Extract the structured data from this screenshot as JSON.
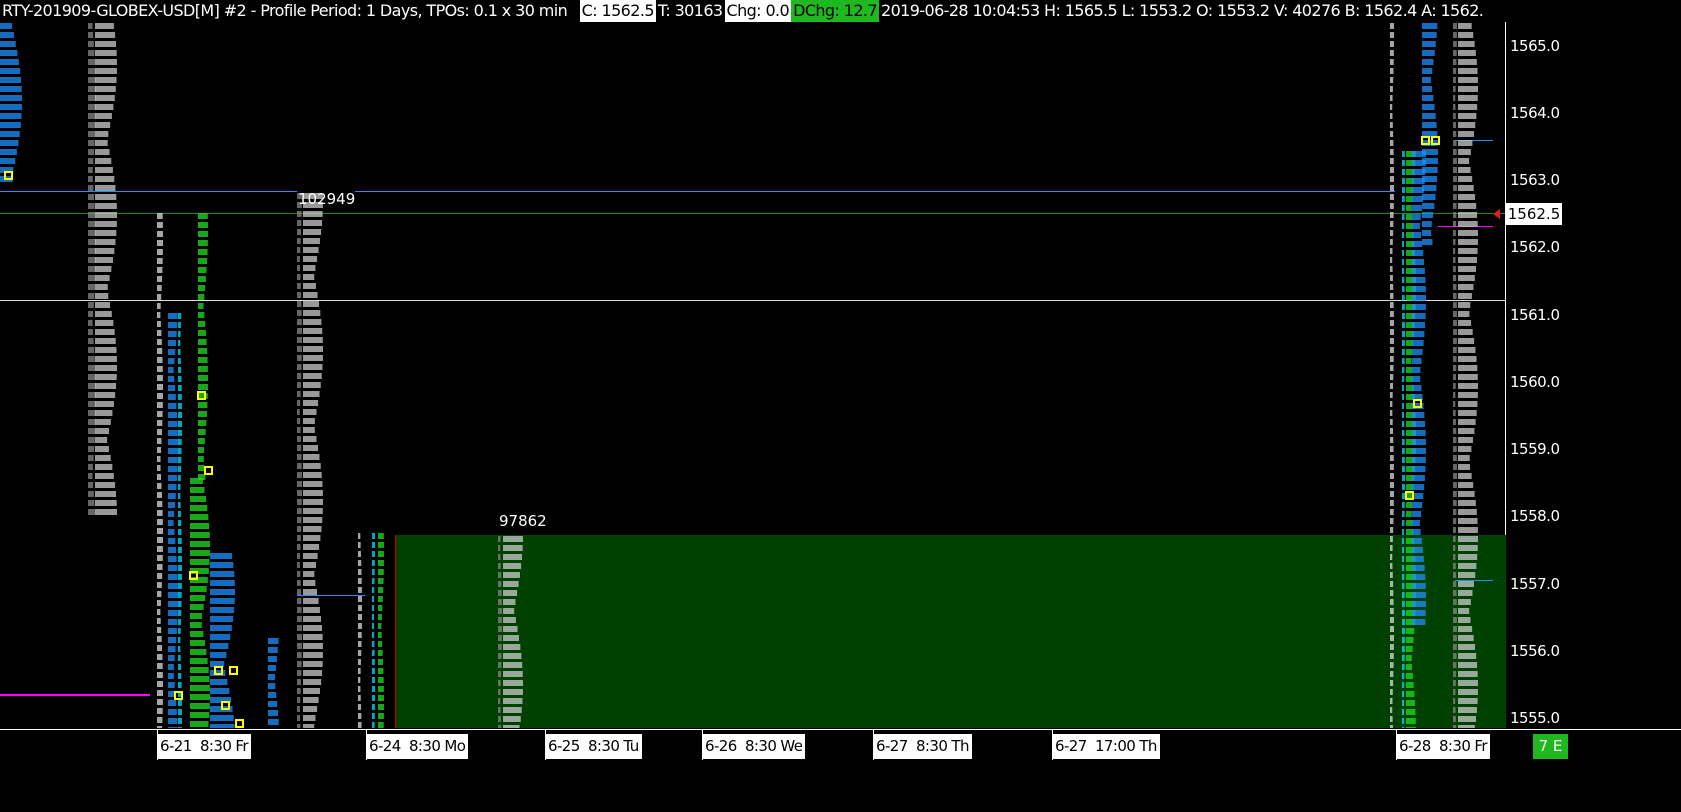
{
  "header": {
    "symbol_title": "RTY-201909-GLOBEX-USD[M]  #2 - Profile Period: 1 Days, TPOs: 0.1 x 30 min",
    "close": "C: 1562.5",
    "ticks": "T: 30163",
    "chg": "Chg: 0.0",
    "dchg": "DChg: 12.7",
    "details": "2019-06-28 10:04:53 H: 1565.5 L: 1553.2 O: 1553.2 V: 40276 B: 1562.4 A: 1562."
  },
  "colors": {
    "dchg_bg": "#1fb81f",
    "value_area": "#004000",
    "tpo_blue": "#1e90ff",
    "tpo_green": "#22dd22",
    "poc": "#ffff00",
    "vwap_line": "#ff00ff"
  },
  "price_axis": {
    "ticks": [
      "1565.0",
      "1564.0",
      "1563.0",
      "1562.0",
      "1561.0",
      "1560.0",
      "1559.0",
      "1558.0",
      "1557.0",
      "1556.0",
      "1555.0"
    ],
    "current_price": "1562.5"
  },
  "profiles": {
    "volume_label_1": "102949",
    "volume_label_2": "97862"
  },
  "time_axis": {
    "labels": [
      "6-21  8:30 Fr",
      "6-24  8:30 Mo",
      "6-25  8:30 Tu",
      "6-26  8:30 We",
      "6-27  8:30 Th",
      "6-27  17:00 Th",
      "6-28  8:30 Fr"
    ],
    "status_badge": "7 E"
  }
}
